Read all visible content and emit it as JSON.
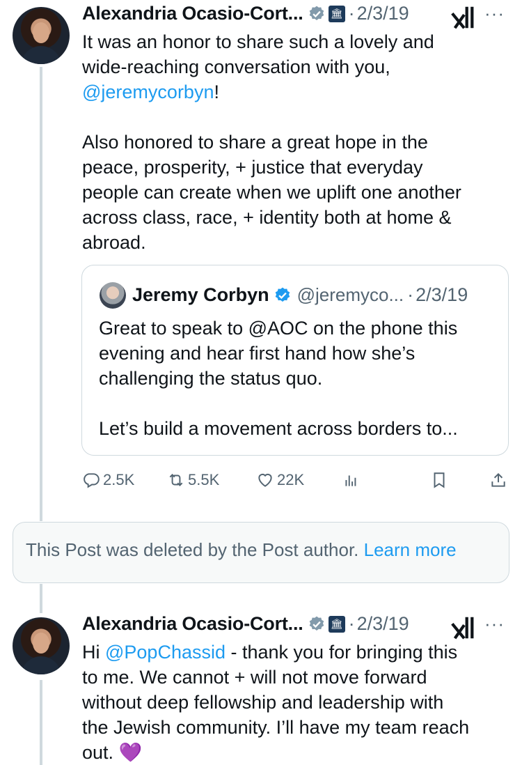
{
  "post1": {
    "author_name": "Alexandria Ocasio-Cort...",
    "date": "2/3/19",
    "text_before_mention": "It was an honor to share such a lovely and\nwide-reaching conversation with you,\n",
    "mention": "@jeremycorbyn",
    "text_after_mention": "!\n\nAlso honored to share a great hope in the\npeace, prosperity, + justice that everyday\npeople can create when we uplift one another\nacross class, race, + identity both at home &\nabroad.",
    "quote": {
      "author_name": "Jeremy Corbyn",
      "handle": "@jeremyco...",
      "date": "2/3/19",
      "text": "Great to speak to @AOC on the phone this\nevening and hear first hand how she’s\nchallenging the status quo.\n\nLet’s build a movement across borders to..."
    },
    "actions": {
      "replies": "2.5K",
      "reposts": "5.5K",
      "likes": "22K"
    }
  },
  "deleted_notice": {
    "text": "This Post was deleted by the Post author.",
    "link": "Learn more"
  },
  "post2": {
    "author_name": "Alexandria Ocasio-Cort...",
    "date": "2/3/19",
    "text_prefix": "Hi ",
    "mention": "@PopChassid",
    "text_suffix": " - thank you for bringing this\nto me. We cannot + will not move forward\nwithout deep fellowship and leadership with\nthe Jewish community. I’ll have my team reach\nout. 💜"
  },
  "separator": "·",
  "more_label": "···",
  "colors": {
    "accent": "#1d9bf0",
    "secondary_text": "#536471",
    "border": "#cfd9de"
  },
  "icons": [
    "verified-icon",
    "government-badge-icon",
    "grok-icon",
    "more-icon",
    "reply-icon",
    "repost-icon",
    "like-icon",
    "views-icon",
    "bookmark-icon",
    "share-icon"
  ]
}
